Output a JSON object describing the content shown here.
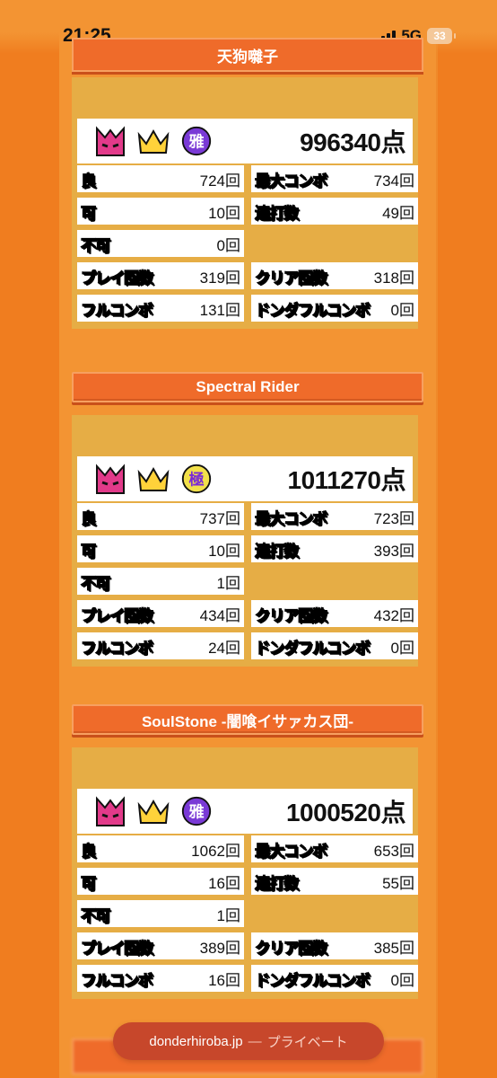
{
  "status_bar": {
    "time": "21:25",
    "network": "5G",
    "battery": "33"
  },
  "url_bar": {
    "domain": "donderhiroba.jp",
    "separator": "—",
    "mode": "プライベート"
  },
  "colors": {
    "page_bg": "#f08a2a",
    "header": "#ef6b2a",
    "card": "#e6ad45"
  },
  "stat_labels": {
    "good": "良",
    "ok": "可",
    "bad": "不可",
    "max_combo": "最大コンボ",
    "drumroll": "連打数",
    "play_count": "プレイ回数",
    "clear_count": "クリア回数",
    "full_combo": "フルコンボ",
    "donderful_combo": "ドンダフルコンボ"
  },
  "songs": [
    {
      "title": "天狗囃子",
      "badges": [
        "oni-difficulty-icon",
        "gold-crown-icon",
        "miyabi-rank-icon"
      ],
      "rank_glyph": "雅",
      "score": "996340点",
      "stats": {
        "good": "724回",
        "max_combo": "734回",
        "ok": "10回",
        "drumroll": "49回",
        "bad": "0回",
        "play_count": "319回",
        "clear_count": "318回",
        "full_combo": "131回",
        "donderful_combo": "0回"
      }
    },
    {
      "title": "Spectral Rider",
      "badges": [
        "oni-difficulty-icon",
        "gold-crown-icon",
        "kiwami-rank-icon"
      ],
      "rank_glyph": "極",
      "score": "1011270点",
      "stats": {
        "good": "737回",
        "max_combo": "723回",
        "ok": "10回",
        "drumroll": "393回",
        "bad": "1回",
        "play_count": "434回",
        "clear_count": "432回",
        "full_combo": "24回",
        "donderful_combo": "0回"
      }
    },
    {
      "title": "SoulStone -闇喰イサァカス団-",
      "badges": [
        "oni-difficulty-icon",
        "gold-crown-icon",
        "miyabi-rank-icon"
      ],
      "rank_glyph": "雅",
      "score": "1000520点",
      "stats": {
        "good": "1062回",
        "max_combo": "653回",
        "ok": "16回",
        "drumroll": "55回",
        "bad": "1回",
        "play_count": "389回",
        "clear_count": "385回",
        "full_combo": "16回",
        "donderful_combo": "0回"
      }
    }
  ]
}
